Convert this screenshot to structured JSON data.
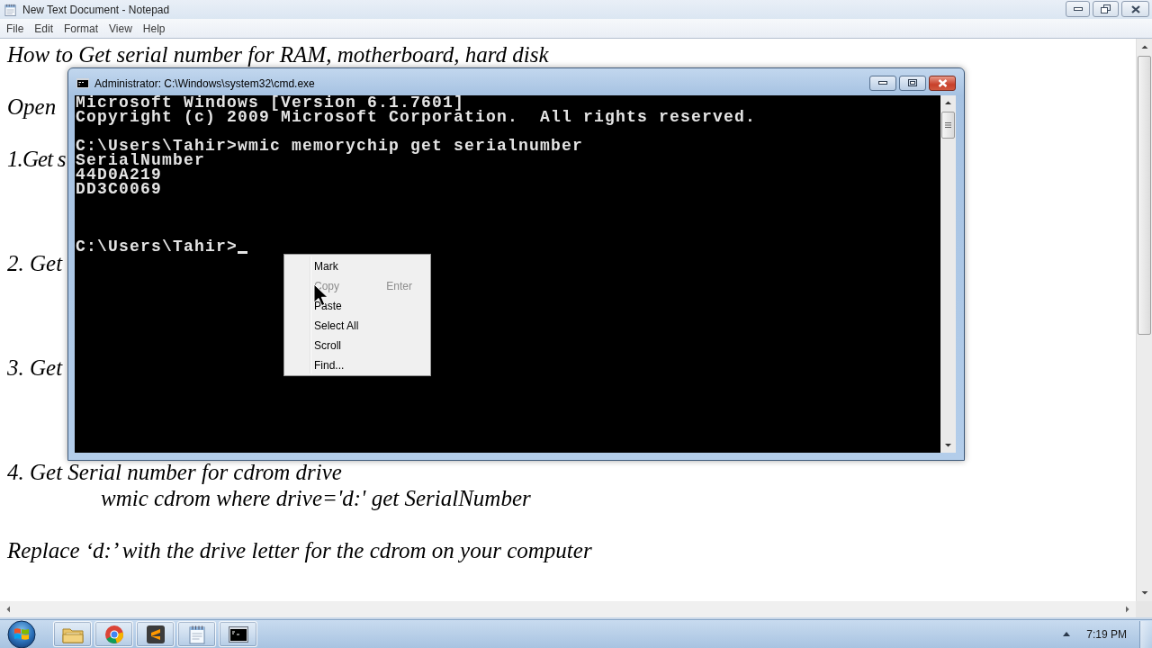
{
  "notepad": {
    "title": "New Text Document - Notepad",
    "menu": [
      "File",
      "Edit",
      "Format",
      "View",
      "Help"
    ],
    "lines": [
      {
        "kind": "text",
        "text": "How to Get serial number for RAM, motherboard, hard disk"
      },
      {
        "kind": "text",
        "text": "Open"
      },
      {
        "kind": "text",
        "text": "1.Get s"
      },
      {
        "kind": "text",
        "text": "2. Get"
      },
      {
        "kind": "text",
        "text": "3. Get"
      },
      {
        "kind": "text",
        "text": "4. Get Serial number for cdrom drive"
      },
      {
        "kind": "command",
        "text": "wmic cdrom where drive='d:' get SerialNumber"
      },
      {
        "kind": "text",
        "text": "Replace ‘d:’ with the drive letter for the cdrom on your computer"
      }
    ]
  },
  "cmd_window": {
    "title": "Administrator: C:\\Windows\\system32\\cmd.exe",
    "lines": [
      "Microsoft Windows [Version 6.1.7601]",
      "Copyright (c) 2009 Microsoft Corporation.  All rights reserved.",
      "C:\\Users\\Tahir>wmic memorychip get serialnumber",
      "SerialNumber",
      "44D0A219",
      "DD3C0069"
    ],
    "prompt": "C:\\Users\\Tahir>",
    "cursor": true
  },
  "context_menu": {
    "items": [
      {
        "label": "Mark",
        "disabled": false
      },
      {
        "label": "Copy",
        "shortcut": "Enter",
        "disabled": true
      },
      {
        "label": "Paste",
        "disabled": false
      },
      {
        "label": "Select All",
        "disabled": false
      },
      {
        "label": "Scroll",
        "disabled": false
      },
      {
        "label": "Find...",
        "disabled": false
      }
    ]
  },
  "taskbar": {
    "apps": [
      {
        "kind": "folder"
      },
      {
        "kind": "browser"
      },
      {
        "kind": "editor"
      },
      {
        "kind": "notepad"
      },
      {
        "kind": "terminal"
      }
    ],
    "clock": "7:19 PM"
  }
}
